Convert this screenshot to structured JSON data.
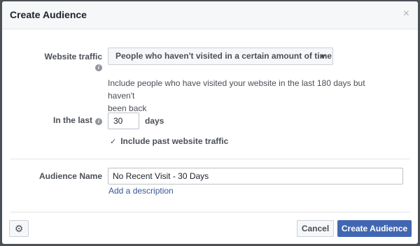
{
  "dialog": {
    "title": "Create Audience",
    "close_glyph": "×"
  },
  "form": {
    "website_traffic": {
      "label": "Website traffic",
      "info_icon": "i",
      "selected_option": "People who haven't visited in a certain amount of time",
      "help_text_line1": "Include people who have visited your website in the last 180 days but haven't",
      "help_text_line2": "been back"
    },
    "in_the_last": {
      "label": "In the last",
      "info_icon": "i",
      "value": "30",
      "unit": "days"
    },
    "include_past": {
      "checked": true,
      "check_glyph": "✓",
      "label": "Include past website traffic"
    },
    "audience_name": {
      "label": "Audience Name",
      "value": "No Recent Visit - 30 Days",
      "add_description": "Add a description"
    }
  },
  "footer": {
    "settings_glyph": "⚙",
    "cancel_label": "Cancel",
    "create_label": "Create Audience"
  },
  "colors": {
    "primary": "#4267b2",
    "link": "#365899",
    "overlay": "#4b4f56"
  }
}
